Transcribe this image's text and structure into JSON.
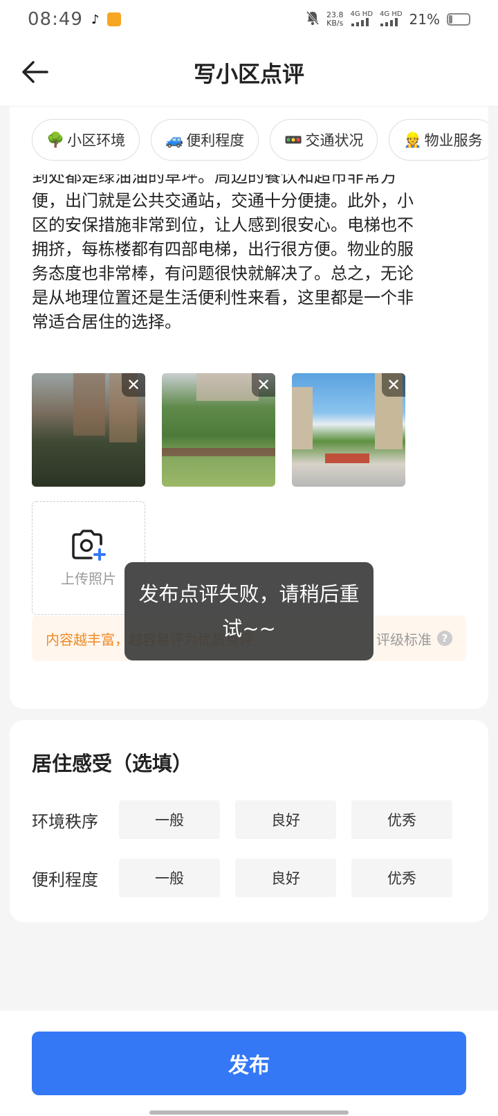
{
  "status_bar": {
    "time": "08:49",
    "net_speed_value": "23.8",
    "net_speed_unit": "KB/s",
    "sim1_label": "4G HD",
    "sim2_label": "4G HD",
    "battery_percent": "21%",
    "battery_level": 0.21
  },
  "header": {
    "title": "写小区点评"
  },
  "tags": [
    {
      "emoji": "🌳",
      "label": "小区环境"
    },
    {
      "emoji": "🚙",
      "label": "便利程度"
    },
    {
      "emoji": "🚥",
      "label": "交通状况"
    },
    {
      "emoji": "👷",
      "label": "物业服务"
    }
  ],
  "review": {
    "text_lines": [
      "到处都是绿油油的草坪。周边的餐饮和超市非常方",
      "便，出门就是公共交通站，交通十分便捷。此外，小",
      "区的安保措施非常到位，让人感到很安心。电梯也不",
      "拥挤，每栋楼都有四部电梯，出行很方便。物业的服",
      "务态度也非常棒，有问题很快就解决了。总之，无论",
      "是从地理位置还是生活便利性来看，这里都是一个非",
      "常适合居住的选择。"
    ]
  },
  "photos": {
    "close_glyph": "✕"
  },
  "upload": {
    "label": "上传照片"
  },
  "tip": {
    "text": "内容越丰富，越容易评为优质点评",
    "link": "评级标准",
    "help_glyph": "?"
  },
  "living_experience": {
    "title": "居住感受（选填）",
    "rows": [
      {
        "label": "环境秩序",
        "options": [
          "一般",
          "良好",
          "优秀"
        ]
      },
      {
        "label": "便利程度",
        "options": [
          "一般",
          "良好",
          "优秀"
        ]
      }
    ]
  },
  "bottom": {
    "publish_label": "发布"
  },
  "toast": {
    "message": "发布点评失败，请稍后重试~~"
  },
  "colors": {
    "primary": "#3478f6",
    "tip_text": "#f08a24",
    "tip_bg": "#fff6ee"
  }
}
